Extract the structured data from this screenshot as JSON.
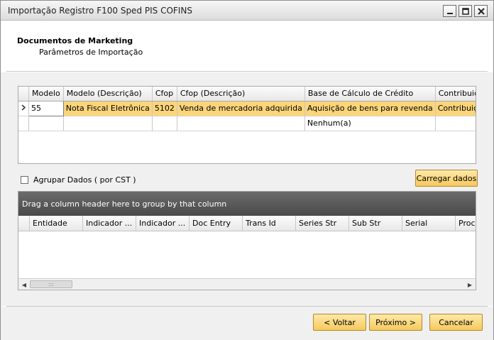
{
  "window": {
    "title": "Importação Registro F100 Sped PIS COFINS",
    "controls": [
      "minimize-icon",
      "maximize-icon",
      "close-icon"
    ]
  },
  "header": {
    "title": "Documentos de Marketing",
    "subtitle": "Parâmetros de Importação"
  },
  "params_grid": {
    "columns": [
      "Modelo",
      "Modelo (Descrição)",
      "Cfop",
      "Cfop (Descrição)",
      "Base de Cálculo de Crédito",
      "Contribuição Social Apurada"
    ],
    "rows": [
      [
        "55",
        "Nota Fiscal Eletrônica",
        "5102",
        "Venda de mercadoria adquirida",
        "Aquisição de bens para revenda",
        "Contribuição não-cumulativa apurada"
      ],
      [
        "",
        "",
        "",
        "",
        "Nenhum(a)",
        ""
      ]
    ]
  },
  "options": {
    "group_label": "Agrupar Dados ( por CST )",
    "load_button": "Carregar dados"
  },
  "results_grid": {
    "group_panel_text": "Drag a column header here to group by that column",
    "columns": [
      "Entidade",
      "Indicador ...",
      "Indicador ...",
      "Doc Entry",
      "Trans Id",
      "Series Str",
      "Sub Str",
      "Serial",
      "Proce"
    ]
  },
  "footer": {
    "back": "< Voltar",
    "next": "Próximo >",
    "cancel": "Cancelar"
  }
}
